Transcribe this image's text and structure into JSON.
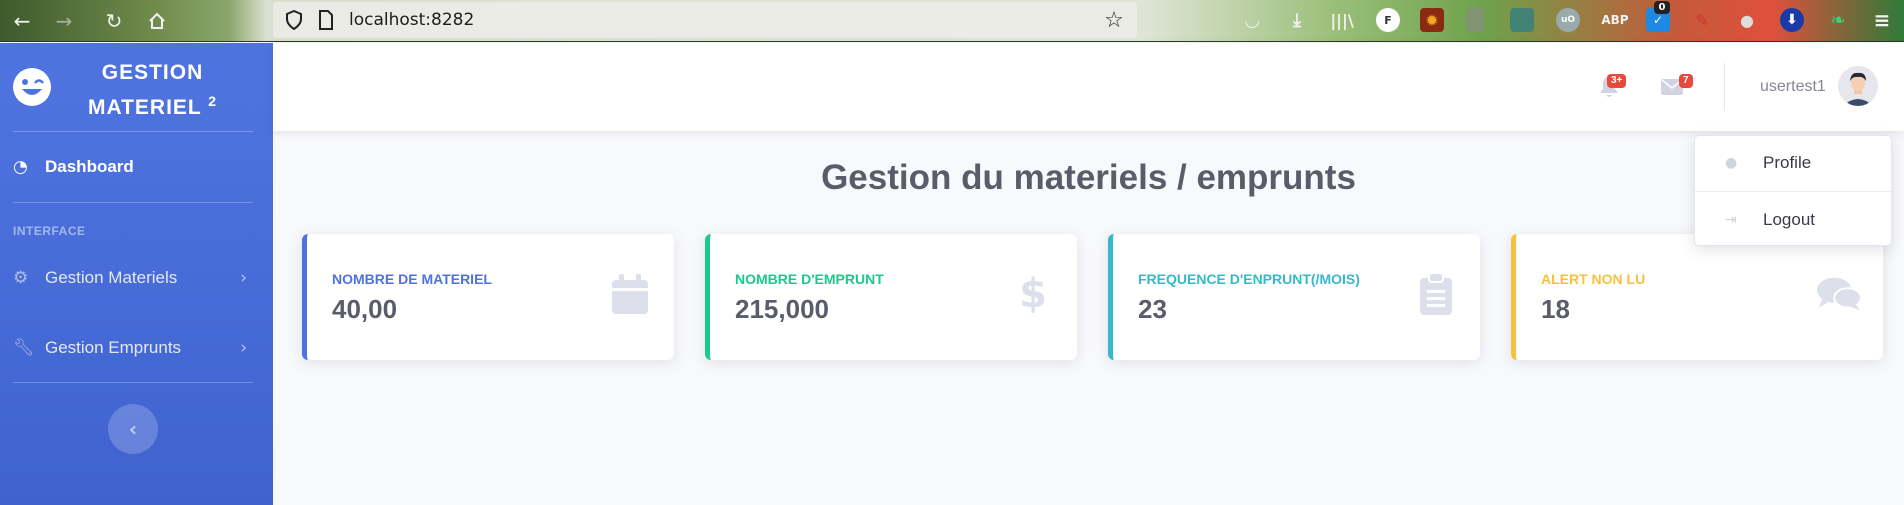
{
  "browser": {
    "url": "localhost:8282",
    "nav_icons": [
      "back-arrow-icon",
      "forward-arrow-icon",
      "reload-icon",
      "home-icon"
    ],
    "ext_badge_count": "0",
    "ext_abp_label": "ABP",
    "ext_f_label": "F"
  },
  "sidebar": {
    "brand_line1": "GESTION",
    "brand_line2": "MATERIEL",
    "brand_sup": "2",
    "dashboard_label": "Dashboard",
    "heading": "INTERFACE",
    "items": [
      {
        "label": "Gestion Materiels"
      },
      {
        "label": "Gestion Emprunts"
      }
    ],
    "color": "#4e73df"
  },
  "topbar": {
    "alerts_badge": "3+",
    "messages_badge": "7",
    "username": "usertest1"
  },
  "main": {
    "title": "Gestion du materiels / emprunts",
    "cards": [
      {
        "label": "NOMBRE DE MATERIEL",
        "value": "40,00",
        "color": "#4e73df",
        "icon": "calendar-icon"
      },
      {
        "label": "NOMBRE D'EMPRUNT",
        "value": "215,000",
        "color": "#1cc88a",
        "icon": "dollar-icon"
      },
      {
        "label": "FREQUENCE D'ENPRUNT(/MOIS)",
        "value": "23",
        "color": "#36b9cc",
        "icon": "clipboard-icon"
      },
      {
        "label": "ALERT NON LU",
        "value": "18",
        "color": "#f6c23e",
        "icon": "comments-icon"
      }
    ]
  },
  "dropdown": {
    "profile_label": "Profile",
    "logout_label": "Logout"
  }
}
